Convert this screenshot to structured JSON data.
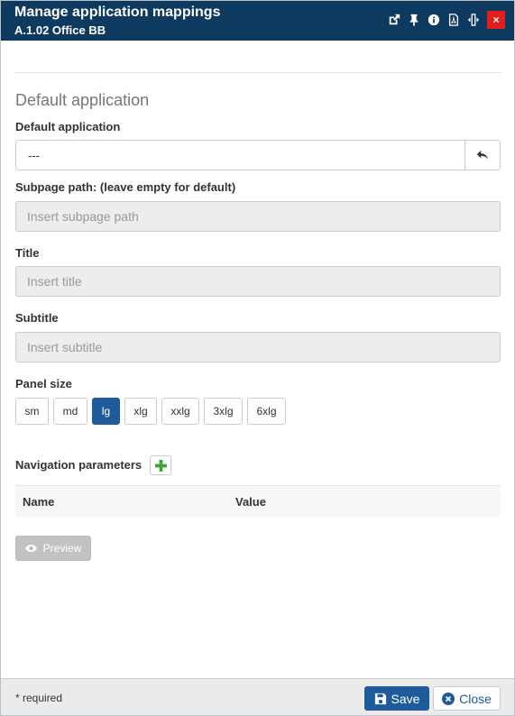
{
  "header": {
    "title": "Manage application mappings",
    "subtitle": "A.1.02 Office BB",
    "icons": [
      "external-link-icon",
      "pin-icon",
      "info-icon",
      "pdf-icon",
      "resize-icon",
      "close-icon"
    ],
    "close_glyph": "×",
    "close_color": "#e21f1f",
    "bg_color": "#0f3a5f"
  },
  "form": {
    "section_title": "Default application",
    "default_app": {
      "label": "Default application",
      "value": "---"
    },
    "subpage": {
      "label": "Subpage path: (leave empty for default)",
      "placeholder": "Insert subpage path"
    },
    "title_field": {
      "label": "Title",
      "placeholder": "Insert title"
    },
    "subtitle_field": {
      "label": "Subtitle",
      "placeholder": "Insert subtitle"
    },
    "panel_size": {
      "label": "Panel size",
      "options": [
        "sm",
        "md",
        "lg",
        "xlg",
        "xxlg",
        "3xlg",
        "6xlg"
      ],
      "selected": "lg"
    },
    "nav_params": {
      "label": "Navigation parameters",
      "columns": [
        "Name",
        "Value"
      ],
      "rows": []
    },
    "preview_label": "Preview"
  },
  "footer": {
    "required_note": "* required",
    "save_label": "Save",
    "close_label": "Close"
  },
  "colors": {
    "primary": "#1f5b9a",
    "add_icon": "#3aa63a",
    "disabled": "#c2c2c2"
  }
}
